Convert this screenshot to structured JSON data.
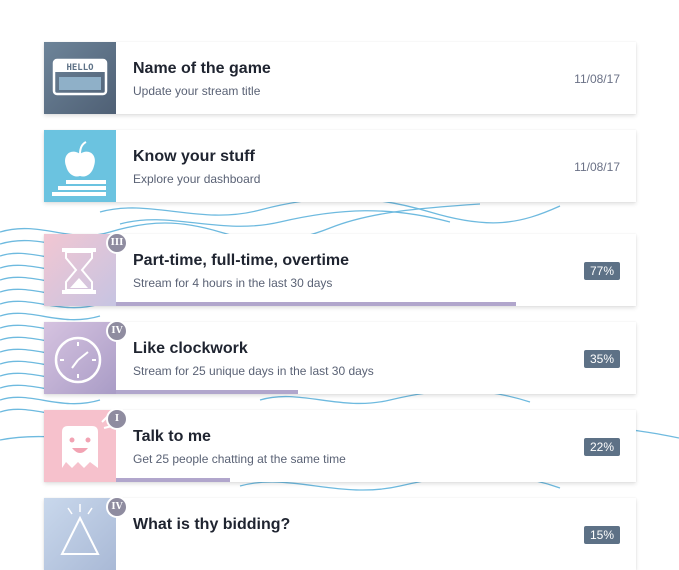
{
  "achievements": [
    {
      "title": "Name of the game",
      "subtitle": "Update your stream title",
      "date": "11/08/17",
      "icon": "hello-name-tag-icon",
      "thumb_color": "#5d7186"
    },
    {
      "title": "Know your stuff",
      "subtitle": "Explore your dashboard",
      "date": "11/08/17",
      "icon": "apple-books-icon",
      "thumb_color": "#6bc3e0"
    },
    {
      "title": "Part-time, full-time, overtime",
      "subtitle": "Stream for 4 hours in the last 30 days",
      "percent": "77%",
      "progress": 0.77,
      "level": "III",
      "icon": "hourglass-icon",
      "thumb_color": "#d8bfd8"
    },
    {
      "title": "Like clockwork",
      "subtitle": "Stream for 25 unique days in the last 30 days",
      "percent": "35%",
      "progress": 0.35,
      "level": "IV",
      "icon": "clock-icon",
      "thumb_color": "#c8b8dc"
    },
    {
      "title": "Talk to me",
      "subtitle": "Get 25 people chatting at the same time",
      "percent": "22%",
      "progress": 0.22,
      "level": "I",
      "icon": "happy-chat-bubble-icon",
      "thumb_color": "#f5bcc8"
    },
    {
      "title": "What is thy bidding?",
      "subtitle": "",
      "percent": "15%",
      "progress": 0.15,
      "level": "IV",
      "icon": "all-seeing-eye-icon",
      "thumb_color": "#c8d6ea"
    }
  ],
  "colors": {
    "wave": "#5fb3dc",
    "progress": "#b1a6cc",
    "percent_badge": "#5d7186"
  }
}
